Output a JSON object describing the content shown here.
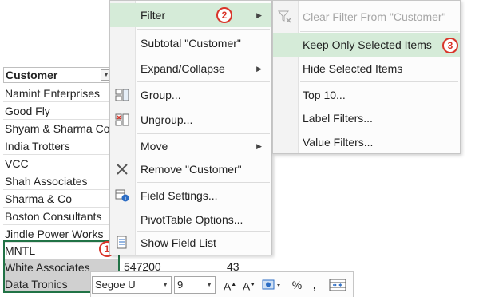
{
  "sheet": {
    "column_header": "Customer",
    "rows": [
      "Namint Enterprises",
      "Good Fly",
      "Shyam & Sharma Co",
      "India Trotters",
      "VCC",
      "Shah Associates",
      "Sharma & Co",
      "Boston Consultants",
      "Jindle Power Works",
      "MNTL",
      "White Associates",
      "Data Tronics"
    ],
    "value_cell": "547200",
    "count_cell": "43",
    "selection_color": "#217346"
  },
  "context_menu": {
    "items": [
      {
        "label": "Filter",
        "submenu": true
      },
      {
        "label": "Subtotal \"Customer\""
      },
      {
        "label": "Expand/Collapse",
        "submenu": true
      },
      {
        "label": "Group..."
      },
      {
        "label": "Ungroup..."
      },
      {
        "label": "Move",
        "submenu": true
      },
      {
        "label": "Remove \"Customer\""
      },
      {
        "label": "Field Settings..."
      },
      {
        "label": "PivotTable Options..."
      },
      {
        "label": "Show Field List"
      }
    ],
    "hover_color": "#d5ebd8"
  },
  "filter_submenu": {
    "items": [
      {
        "label": "Clear Filter From \"Customer\"",
        "disabled": true
      },
      {
        "label": "Keep Only Selected Items"
      },
      {
        "label": "Hide Selected Items"
      },
      {
        "label": "Top 10..."
      },
      {
        "label": "Label Filters..."
      },
      {
        "label": "Value Filters..."
      }
    ]
  },
  "badges": [
    "1",
    "2",
    "3"
  ],
  "mini_toolbar": {
    "font_name": "Segoe U",
    "font_size": "9",
    "grow_label": "A",
    "shrink_label": "A",
    "percent_label": "%",
    "comma_label": ","
  },
  "colors": {
    "badge": "#d9352a",
    "excel_green": "#217346"
  }
}
